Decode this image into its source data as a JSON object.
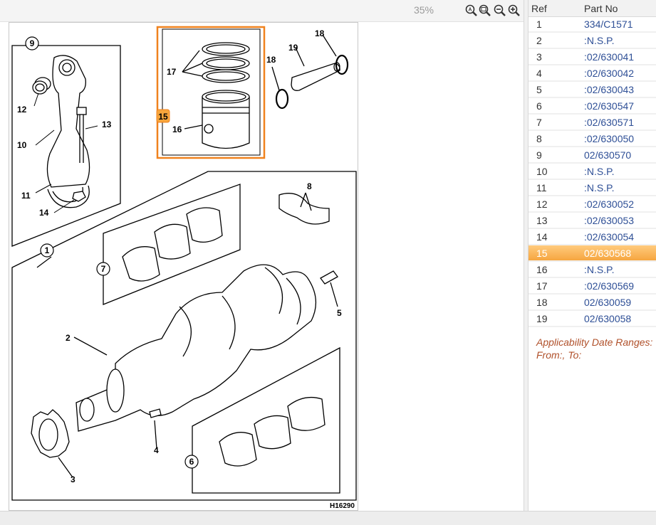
{
  "toolbar": {
    "zoom_level": "35%",
    "zoom_icons": [
      "zoom-fit-icon",
      "zoom-actual-icon",
      "zoom-out-icon",
      "zoom-in-icon"
    ]
  },
  "diagram": {
    "callouts": [
      "1",
      "2",
      "3",
      "4",
      "5",
      "6",
      "7",
      "8",
      "9",
      "10",
      "11",
      "12",
      "13",
      "14",
      "15",
      "16",
      "17",
      "18",
      "18",
      "19"
    ],
    "code": "H16290",
    "highlight_color": "#f0821e"
  },
  "parts_table": {
    "headers": {
      "ref": "Ref",
      "part_no": "Part No"
    },
    "rows": [
      {
        "ref": "1",
        "part_no": "334/C1571"
      },
      {
        "ref": "2",
        "part_no": ":N.S.P."
      },
      {
        "ref": "3",
        "part_no": ":02/630041"
      },
      {
        "ref": "4",
        "part_no": ":02/630042"
      },
      {
        "ref": "5",
        "part_no": ":02/630043"
      },
      {
        "ref": "6",
        "part_no": ":02/630547"
      },
      {
        "ref": "7",
        "part_no": ":02/630571"
      },
      {
        "ref": "8",
        "part_no": ":02/630050"
      },
      {
        "ref": "9",
        "part_no": "02/630570"
      },
      {
        "ref": "10",
        "part_no": ":N.S.P."
      },
      {
        "ref": "11",
        "part_no": ":N.S.P."
      },
      {
        "ref": "12",
        "part_no": ":02/630052"
      },
      {
        "ref": "13",
        "part_no": ":02/630053"
      },
      {
        "ref": "14",
        "part_no": ":02/630054"
      },
      {
        "ref": "15",
        "part_no": "02/630568"
      },
      {
        "ref": "16",
        "part_no": ":N.S.P."
      },
      {
        "ref": "17",
        "part_no": ":02/630569"
      },
      {
        "ref": "18",
        "part_no": "02/630059"
      },
      {
        "ref": "19",
        "part_no": "02/630058"
      }
    ],
    "selected_ref": "15",
    "selected_color": "#f7a53c"
  },
  "applicability": {
    "title": "Applicability Date Ranges:",
    "range": "From:, To:"
  }
}
